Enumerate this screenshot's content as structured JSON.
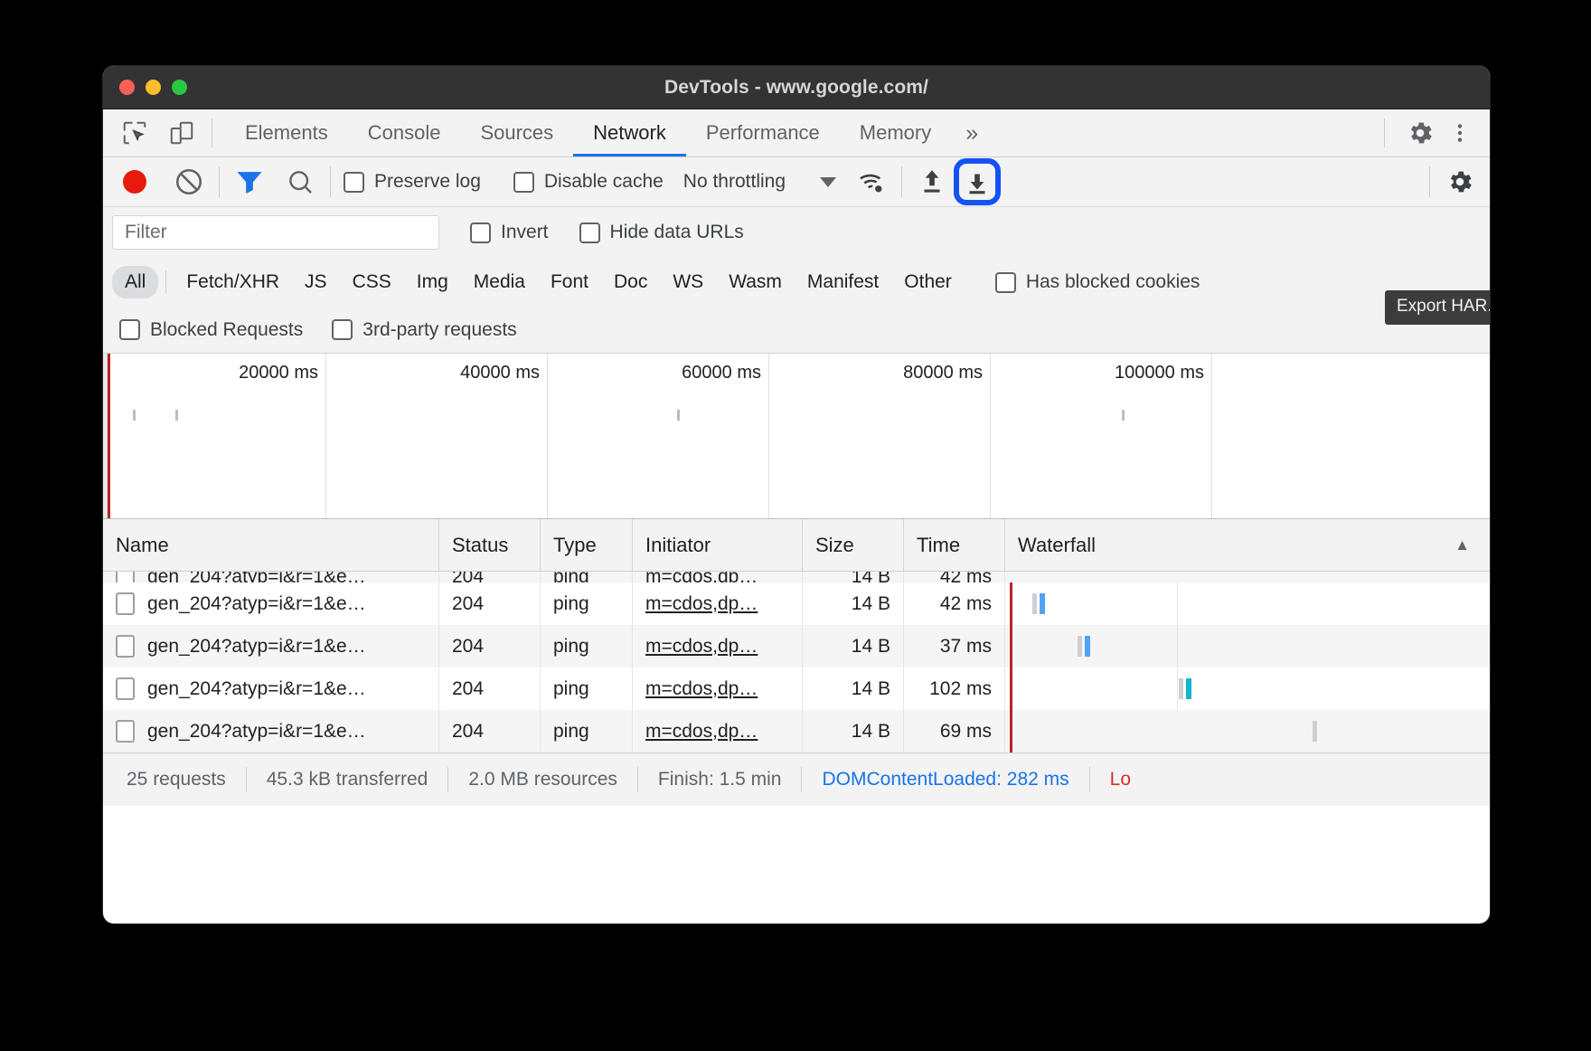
{
  "window": {
    "title": "DevTools - www.google.com/",
    "traffic_lights": [
      "close-red",
      "minimize-yellow",
      "maximize-green"
    ]
  },
  "tabstrip": {
    "icons": [
      "inspect-element-icon",
      "device-toolbar-icon"
    ],
    "tabs": [
      {
        "label": "Elements",
        "active": false
      },
      {
        "label": "Console",
        "active": false
      },
      {
        "label": "Sources",
        "active": false
      },
      {
        "label": "Network",
        "active": true
      },
      {
        "label": "Performance",
        "active": false
      },
      {
        "label": "Memory",
        "active": false
      }
    ],
    "more_label": "»",
    "right_icons": [
      "settings-gear-icon",
      "more-vertical-icon"
    ]
  },
  "network_toolbar": {
    "record_title": "record-button",
    "clear_title": "clear-button",
    "filter_icon": "filter-funnel-icon",
    "search_icon": "search-icon",
    "preserve_log": "Preserve log",
    "disable_cache": "Disable cache",
    "throttling_value": "No throttling",
    "wifi_icon": "network-conditions-icon",
    "import_icon": "import-har-icon",
    "export_icon": "export-har-icon",
    "settings_icon": "settings-gear-icon",
    "tooltip": "Export HAR...",
    "highlight_color": "#1452f3",
    "record_color": "#e8190f",
    "filter_active_color": "#1a73e8"
  },
  "filter_bar": {
    "filter_placeholder": "Filter",
    "filter_value": "",
    "invert": "Invert",
    "hide_data_urls": "Hide data URLs"
  },
  "type_filters": {
    "items": [
      {
        "label": "All",
        "selected": true
      },
      {
        "label": "Fetch/XHR",
        "selected": false
      },
      {
        "label": "JS",
        "selected": false
      },
      {
        "label": "CSS",
        "selected": false
      },
      {
        "label": "Img",
        "selected": false
      },
      {
        "label": "Media",
        "selected": false
      },
      {
        "label": "Font",
        "selected": false
      },
      {
        "label": "Doc",
        "selected": false
      },
      {
        "label": "WS",
        "selected": false
      },
      {
        "label": "Wasm",
        "selected": false
      },
      {
        "label": "Manifest",
        "selected": false
      },
      {
        "label": "Other",
        "selected": false
      }
    ],
    "has_blocked_cookies": "Has blocked cookies",
    "blocked_requests": "Blocked Requests",
    "third_party_requests": "3rd-party requests"
  },
  "overview": {
    "ticks": [
      "20000 ms",
      "40000 ms",
      "60000 ms",
      "80000 ms",
      "100000 ms"
    ]
  },
  "table": {
    "columns": [
      "Name",
      "Status",
      "Type",
      "Initiator",
      "Size",
      "Time",
      "Waterfall"
    ],
    "sort_indicator": "▲",
    "rows": [
      {
        "name": "gen_204?atyp=i&r=1&e…",
        "status": "204",
        "type": "ping",
        "initiator": "m=cdos,dp…",
        "size": "14 B",
        "time": "42 ms"
      },
      {
        "name": "gen_204?atyp=i&r=1&e…",
        "status": "204",
        "type": "ping",
        "initiator": "m=cdos,dp…",
        "size": "14 B",
        "time": "37 ms"
      },
      {
        "name": "gen_204?atyp=i&r=1&e…",
        "status": "204",
        "type": "ping",
        "initiator": "m=cdos,dp…",
        "size": "14 B",
        "time": "102 ms"
      },
      {
        "name": "gen_204?atyp=i&r=1&e…",
        "status": "204",
        "type": "ping",
        "initiator": "m=cdos,dp…",
        "size": "14 B",
        "time": "69 ms"
      }
    ]
  },
  "statusbar": {
    "requests": "25 requests",
    "transferred": "45.3 kB transferred",
    "resources": "2.0 MB resources",
    "finish": "Finish: 1.5 min",
    "dom_content_loaded": "DOMContentLoaded: 282 ms",
    "load": "Lo",
    "dcl_color": "#1a73e8",
    "load_color": "#d93025"
  }
}
